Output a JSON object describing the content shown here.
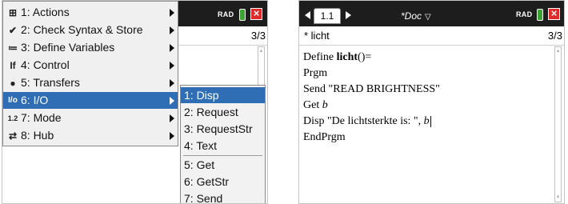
{
  "left_screen": {
    "titlebar": {
      "rad": "RAD"
    },
    "header": {
      "count": "3/3"
    },
    "menu": {
      "items": [
        {
          "icon": "⊞",
          "icon_name": "actions-icon",
          "label": "1: Actions",
          "selected": false
        },
        {
          "icon": "✔",
          "icon_name": "check-syntax-icon",
          "label": "2: Check Syntax & Store",
          "selected": false
        },
        {
          "icon": "≔",
          "icon_name": "define-variables-icon",
          "label": "3: Define Variables",
          "selected": false
        },
        {
          "icon": "If",
          "icon_name": "control-icon",
          "label": "4: Control",
          "selected": false
        },
        {
          "icon": "●",
          "icon_name": "transfers-icon",
          "label": "5: Transfers",
          "selected": false
        },
        {
          "icon": "I/o",
          "icon_name": "io-icon",
          "label": "6: I/O",
          "selected": true
        },
        {
          "icon": "1.2",
          "icon_name": "mode-icon",
          "label": "7: Mode",
          "selected": false
        },
        {
          "icon": "⇄",
          "icon_name": "hub-icon",
          "label": "8: Hub",
          "selected": false
        }
      ]
    },
    "submenu": {
      "items": [
        {
          "label": "1: Disp",
          "selected": true
        },
        {
          "label": "2: Request",
          "selected": false
        },
        {
          "label": "3: RequestStr",
          "selected": false
        },
        {
          "label": "4: Text",
          "selected": false
        },
        {
          "label": "5: Get",
          "selected": false
        },
        {
          "label": "6: GetStr",
          "selected": false
        },
        {
          "label": "7: Send",
          "selected": false
        }
      ]
    }
  },
  "right_screen": {
    "titlebar": {
      "tab": "1.1",
      "doc_title": "*Doc",
      "rad": "RAD"
    },
    "header": {
      "program_name": "* licht",
      "count": "3/3"
    },
    "editor": {
      "line1_keyword": "Define ",
      "line1_name": "licht",
      "line1_args": "()=",
      "line2": "Prgm",
      "line3": "Send \"READ BRIGHTNESS\"",
      "line4_keyword": "Get ",
      "line4_var": "b",
      "line5_text": "Disp \"De lichtsterkte is: \", ",
      "line5_var": "b",
      "line6": "EndPrgm"
    }
  },
  "colors": {
    "titlebar": "#1d1d1d",
    "selection": "#2f6eb5",
    "battery": "#3aa232",
    "close": "#e02a2a"
  }
}
